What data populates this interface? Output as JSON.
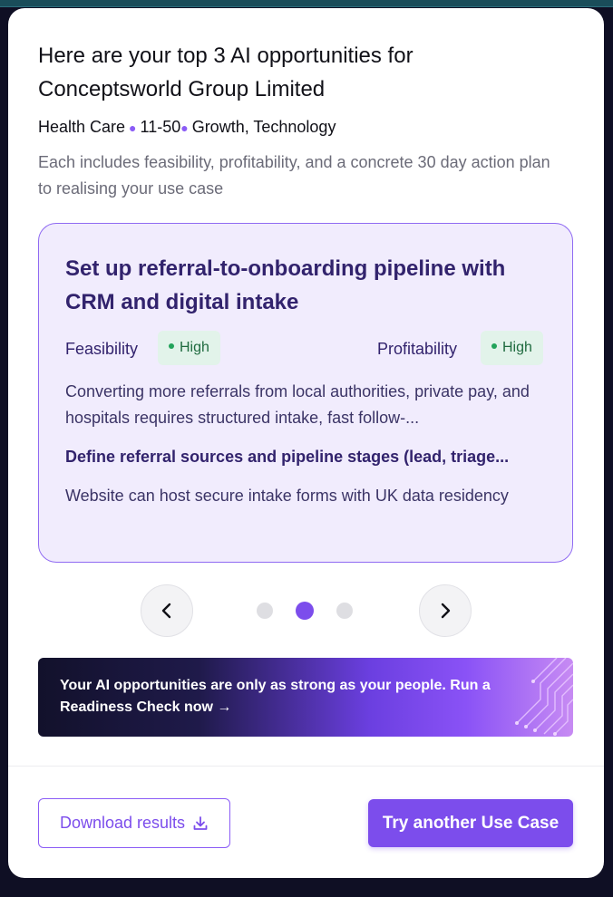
{
  "modal": {
    "headline": "Here are your top 3 AI opportunities for Conceptsworld Group Limited",
    "meta": {
      "industry": "Health Care",
      "size": "11-50",
      "stage": "Growth, Technology"
    },
    "subtitle": "Each includes feasibility, profitability, and a concrete 30 day action plan to realising your use case"
  },
  "card": {
    "title": "Set up referral-to-onboarding pipeline with CRM and digital intake",
    "feasibility_label": "Feasibility",
    "feasibility_value": "High",
    "profitability_label": "Profitability",
    "profitability_value": "High",
    "description": "Converting more referrals from local authorities, private pay, and hospitals requires structured intake, fast follow-...",
    "first_step": "Define referral sources and pipeline stages (lead, triage...",
    "note": "Website can host secure intake forms with UK data residency"
  },
  "carousel": {
    "total": 3,
    "active_index": 1,
    "prev_icon": "chevron-left-icon",
    "next_icon": "chevron-right-icon"
  },
  "banner": {
    "text": "Your AI opportunities are only as strong as your people. Run a Readiness Check now →"
  },
  "footer": {
    "download_label": "Download results",
    "download_icon": "download-icon",
    "try_label": "Try another Use Case"
  },
  "colors": {
    "accent": "#7c4dec",
    "card_bg": "#f1ecfd",
    "badge_green": "#22a35a",
    "title_purple": "#32236d"
  }
}
